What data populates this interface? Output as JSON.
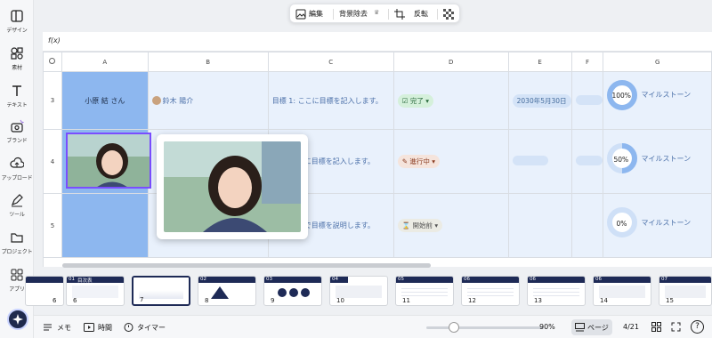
{
  "sidebar": {
    "items": [
      {
        "label": "デザイン",
        "icon": "layout-icon"
      },
      {
        "label": "素材",
        "icon": "elements-icon"
      },
      {
        "label": "テキスト",
        "icon": "text-icon"
      },
      {
        "label": "ブランド",
        "icon": "brand-icon"
      },
      {
        "label": "アップロード",
        "icon": "upload-icon"
      },
      {
        "label": "ツール",
        "icon": "draw-icon"
      },
      {
        "label": "プロジェクト",
        "icon": "folder-icon"
      },
      {
        "label": "アプリ",
        "icon": "apps-icon"
      }
    ]
  },
  "toolbar": {
    "edit": "編集",
    "remove_bg": "背景除去",
    "flip": "反転"
  },
  "formula": {
    "label": "f(x)"
  },
  "grid": {
    "columns": [
      "A",
      "B",
      "C",
      "D",
      "E",
      "F",
      "G"
    ],
    "rows": [
      {
        "num": "3",
        "a": "小原 結 さん",
        "b": "鈴木 陽介",
        "c": "目標 1: ここに目標を記入します。",
        "status": "完了",
        "date": "2030年5月30日",
        "progress": "100%"
      },
      {
        "num": "4",
        "a": "",
        "b": "",
        "c": "ここに目標を記入します。",
        "status": "進行中",
        "date": "",
        "progress": "50%"
      },
      {
        "num": "5",
        "a": "",
        "b": "",
        "c": "ここで目標を説明します。",
        "status": "開始前",
        "date": "",
        "progress": "0%"
      }
    ],
    "milestone_text": "マイルストーン"
  },
  "pages": [
    {
      "num": "01",
      "title": "目次表",
      "foot": "6"
    },
    {
      "num": "02",
      "title": "",
      "foot": "7"
    },
    {
      "num": "",
      "title": "",
      "foot": "8"
    },
    {
      "num": "03",
      "title": "",
      "foot": "9"
    },
    {
      "num": "04",
      "title": "",
      "foot": "10"
    },
    {
      "num": "05",
      "title": "",
      "foot": "11"
    },
    {
      "num": "06",
      "title": "",
      "foot": "12"
    },
    {
      "num": "06",
      "title": "",
      "foot": "13"
    },
    {
      "num": "06",
      "title": "",
      "foot": "14"
    },
    {
      "num": "07",
      "title": "",
      "foot": "15"
    }
  ],
  "bottom": {
    "memo": "メモ",
    "time": "時間",
    "timer": "タイマー",
    "zoom": "90%",
    "page_btn": "ページ",
    "page_count": "4/21",
    "help": "?"
  }
}
